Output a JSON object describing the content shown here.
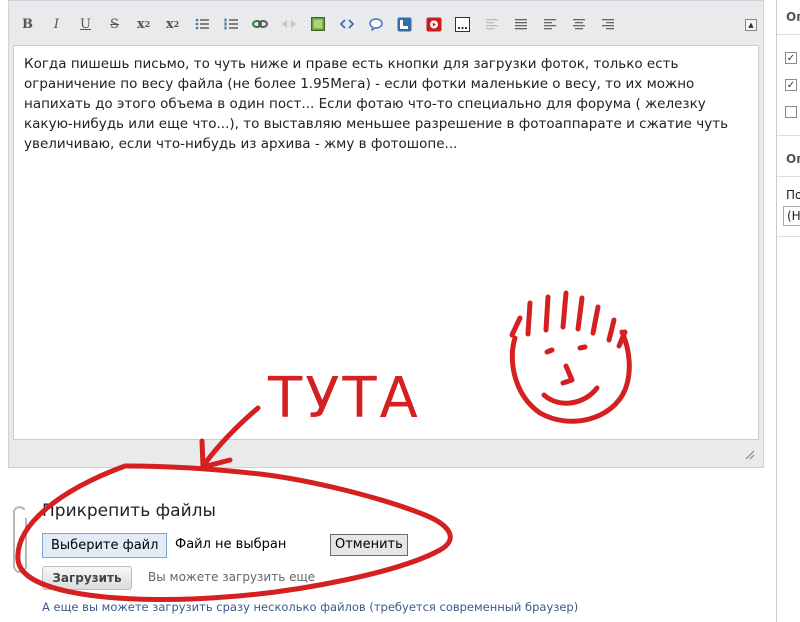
{
  "toolbar": {
    "buttons": [
      {
        "name": "bold-button",
        "glyph": "B"
      },
      {
        "name": "italic-button",
        "glyph": "I"
      },
      {
        "name": "underline-button",
        "glyph": "U"
      },
      {
        "name": "strikethrough-button",
        "glyph": "S"
      }
    ],
    "subscript_glyph": "x",
    "subscript_index": "2",
    "superscript_glyph": "x",
    "superscript_index": "2",
    "collapse_glyph": "▲"
  },
  "editor": {
    "body_text": "Когда пишешь письмо, то чуть ниже и праве есть кнопки для загрузки фоток, только есть ограничение по весу файла (не более 1.95Мега) - если фотки маленькие о весу, то их можно напихать до этого объема в один пост... Если фотаю что-то специально для форума ( железку какую-нибудь или еще что...), то выставляю меньшее разрешение в фотоаппарате и сжатие чуть увеличиваю, если что-нибудь из архива - жму в фотошопе..."
  },
  "annotation": {
    "text": "ТУТА",
    "color": "#d42020"
  },
  "sidebar": {
    "header_1": "Ог",
    "checkbox_1_mark": "✓",
    "checkbox_2_mark": "✓",
    "checkbox_3_mark": "",
    "header_2": "Ог",
    "field_label": "По",
    "select_value": "(Н"
  },
  "attach": {
    "title": "Прикрепить файлы",
    "choose_file_label": "Выберите файл",
    "file_status": "Файл не выбран",
    "cancel_label": "Отменить",
    "upload_label": "Загрузить",
    "upload_hint": "Вы можете загрузить еще",
    "multi_upload_link": "А еще вы можете загрузить сразу несколько файлов (требуется современный браузер)"
  }
}
